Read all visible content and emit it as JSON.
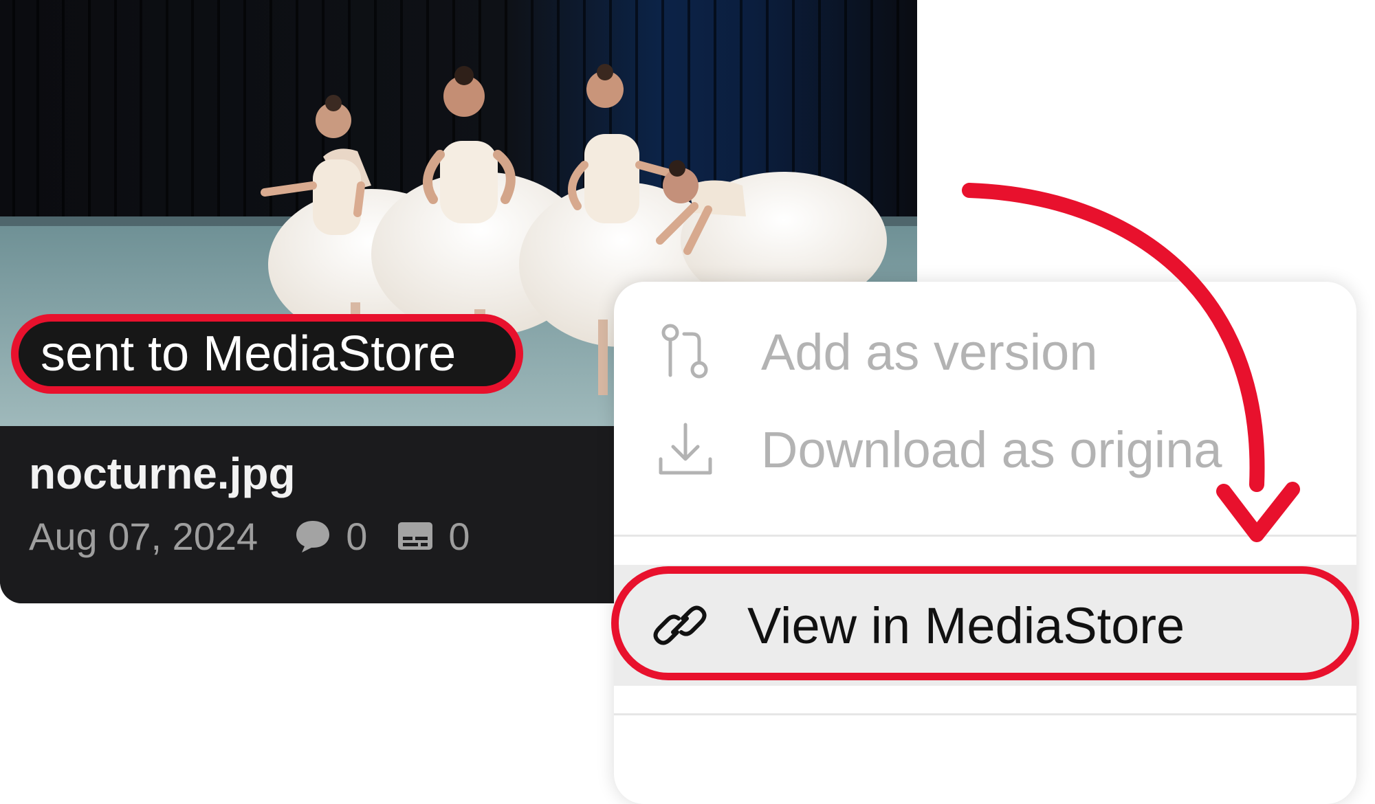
{
  "asset_card": {
    "status_label": "sent to MediaStore",
    "file_name": "nocturne.jpg",
    "date": "Aug 07, 2024",
    "comments_count": "0",
    "subtitles_count": "0",
    "comment_icon": "speech-bubble-icon",
    "subtitle_icon": "subtitles-icon"
  },
  "context_menu": {
    "items": [
      {
        "label": "Add as version",
        "icon": "version-branch-icon",
        "state": "disabled"
      },
      {
        "label": "Download as origina",
        "icon": "download-icon",
        "state": "disabled"
      },
      {
        "label": "View in MediaStore",
        "icon": "link-icon",
        "state": "highlighted"
      }
    ]
  },
  "colors": {
    "highlight": "#e8112d",
    "card_background": "#1b1b1d",
    "menu_background": "#ffffff",
    "disabled_text": "#b3b3b3"
  }
}
